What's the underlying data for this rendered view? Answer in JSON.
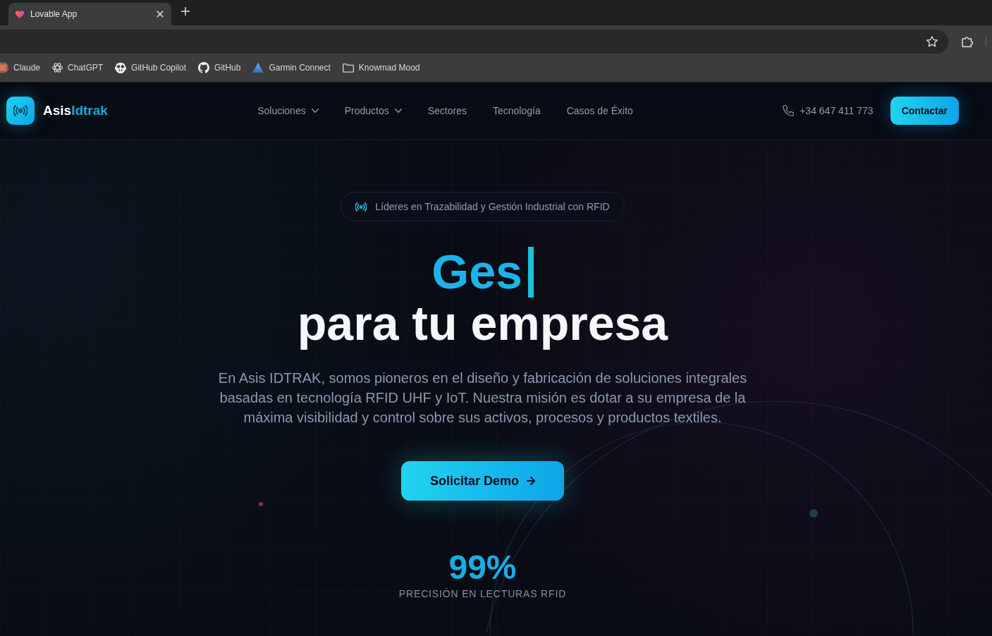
{
  "browser": {
    "tabs": [
      {
        "title": "Lovable App",
        "selected": true
      }
    ],
    "bookmarks": [
      {
        "label": "Claude",
        "kind": "link"
      },
      {
        "label": "ChatGPT",
        "kind": "link"
      },
      {
        "label": "GitHub Copilot",
        "kind": "link"
      },
      {
        "label": "GitHub",
        "kind": "link"
      },
      {
        "label": "Garmin Connect",
        "kind": "link"
      },
      {
        "label": "Knowmad Mood",
        "kind": "folder"
      }
    ]
  },
  "nav": {
    "brand": {
      "name": "Asis",
      "accent": "Idtrak"
    },
    "links": [
      {
        "label": "Soluciones",
        "has_dropdown": true
      },
      {
        "label": "Productos",
        "has_dropdown": true
      },
      {
        "label": "Sectores",
        "has_dropdown": false
      },
      {
        "label": "Tecnología",
        "has_dropdown": false
      },
      {
        "label": "Casos de Éxito",
        "has_dropdown": false
      }
    ],
    "phone": "+34 647 411 773",
    "cta": "Contactar"
  },
  "hero": {
    "tagline": "Líderes en Trazabilidad y Gestión Industrial con RFID",
    "headline_typed": "Ges",
    "headline_rest": "para tu empresa",
    "description": "En Asis IDTRAK, somos pioneros en el diseño y fabricación de soluciones integrales basadas en tecnología RFID UHF y IoT. Nuestra misión es dotar a su empresa de la máxima visibilidad y control sobre sus activos, procesos y productos textiles.",
    "cta": "Solicitar Demo",
    "stat": {
      "value": "99%",
      "label": "PRECISIÓN EN LECTURAS RFID"
    }
  }
}
